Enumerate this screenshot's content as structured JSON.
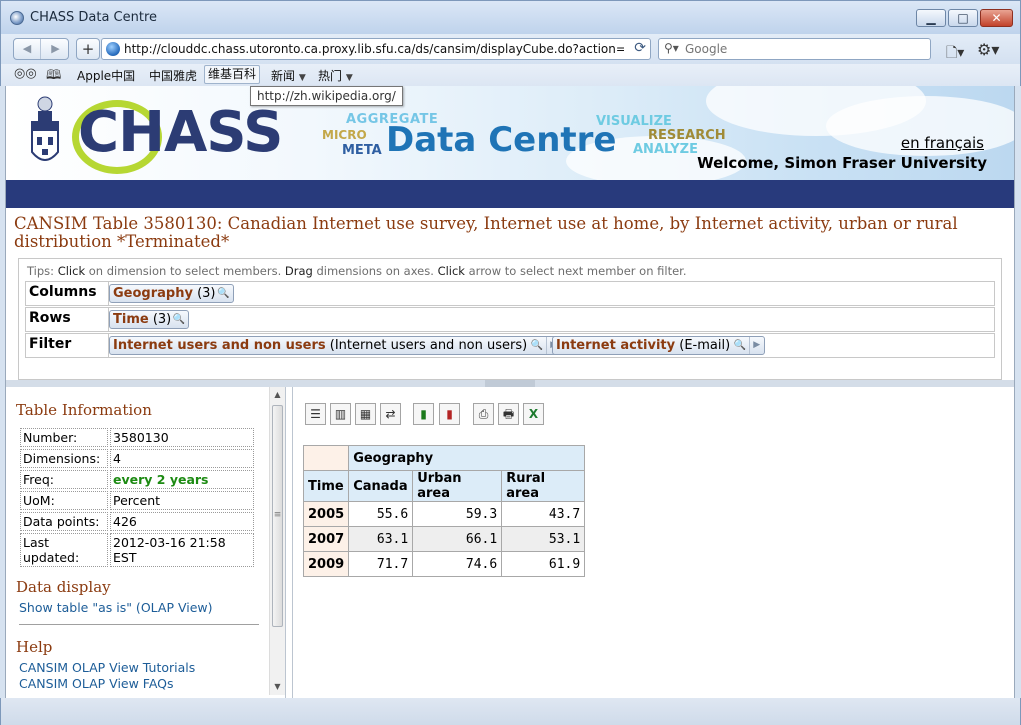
{
  "window": {
    "title": "CHASS Data Centre"
  },
  "nav": {
    "url": "http://clouddc.chass.utoronto.ca.proxy.lib.sfu.ca/ds/cansim/displayCube.do?action=brc",
    "search_placeholder": "Google"
  },
  "bookmarks": [
    "Apple中国",
    "中国雅虎",
    "维基百科",
    "新闻",
    "热门"
  ],
  "tooltip": "http://zh.wikipedia.org/",
  "banner": {
    "logo": "CHASS",
    "aggregate": "AGGREGATE",
    "micro": "MICRO",
    "meta": "META",
    "data_centre": "Data Centre",
    "visualize": "VISUALIZE",
    "research": "RESEARCH",
    "analyze": "ANALYZE",
    "lang_link": "en français",
    "welcome": "Welcome, Simon Fraser University"
  },
  "table_title": "CANSIM Table 3580130: Canadian Internet use survey, Internet use at home, by Internet activity, urban or rural distribution *Terminated*",
  "tips": {
    "prefix": "Tips:",
    "click": "Click",
    "t1": "on dimension to select members.",
    "drag": "Drag",
    "t2": "dimensions on axes.",
    "click2": "Click",
    "t3": "arrow to select next member on filter."
  },
  "dimensions": {
    "columns": {
      "label": "Columns",
      "chip_name": "Geography",
      "chip_val": "(3)"
    },
    "rows": {
      "label": "Rows",
      "chip_name": "Time",
      "chip_val": "(3)"
    },
    "filter": {
      "label": "Filter",
      "chip1_name": "Internet users and non users",
      "chip1_val": "(Internet users and non users)",
      "chip2_name": "Internet activity",
      "chip2_val": "(E-mail)"
    }
  },
  "table_info": {
    "heading": "Table Information",
    "rows": [
      {
        "k": "Number:",
        "v": "3580130"
      },
      {
        "k": "Dimensions:",
        "v": "4"
      },
      {
        "k": "Freq:",
        "v": "every 2 years"
      },
      {
        "k": "UoM:",
        "v": "Percent"
      },
      {
        "k": "Data points:",
        "v": "426"
      },
      {
        "k": "Last updated:",
        "v": "2012-03-16 21:58 EST"
      }
    ]
  },
  "data_display": {
    "heading": "Data display",
    "link": "Show table \"as is\" (OLAP View)"
  },
  "help": {
    "heading": "Help",
    "link1": "CANSIM OLAP View Tutorials",
    "link2": "CANSIM OLAP View FAQs"
  },
  "data_table": {
    "col_dim": "Geography",
    "row_dim": "Time",
    "columns": [
      "Canada",
      "Urban area",
      "Rural area"
    ],
    "rows": [
      {
        "label": "2005",
        "values": [
          "55.6",
          "59.3",
          "43.7"
        ]
      },
      {
        "label": "2007",
        "values": [
          "63.1",
          "66.1",
          "53.1"
        ]
      },
      {
        "label": "2009",
        "values": [
          "71.7",
          "74.6",
          "61.9"
        ]
      }
    ]
  }
}
